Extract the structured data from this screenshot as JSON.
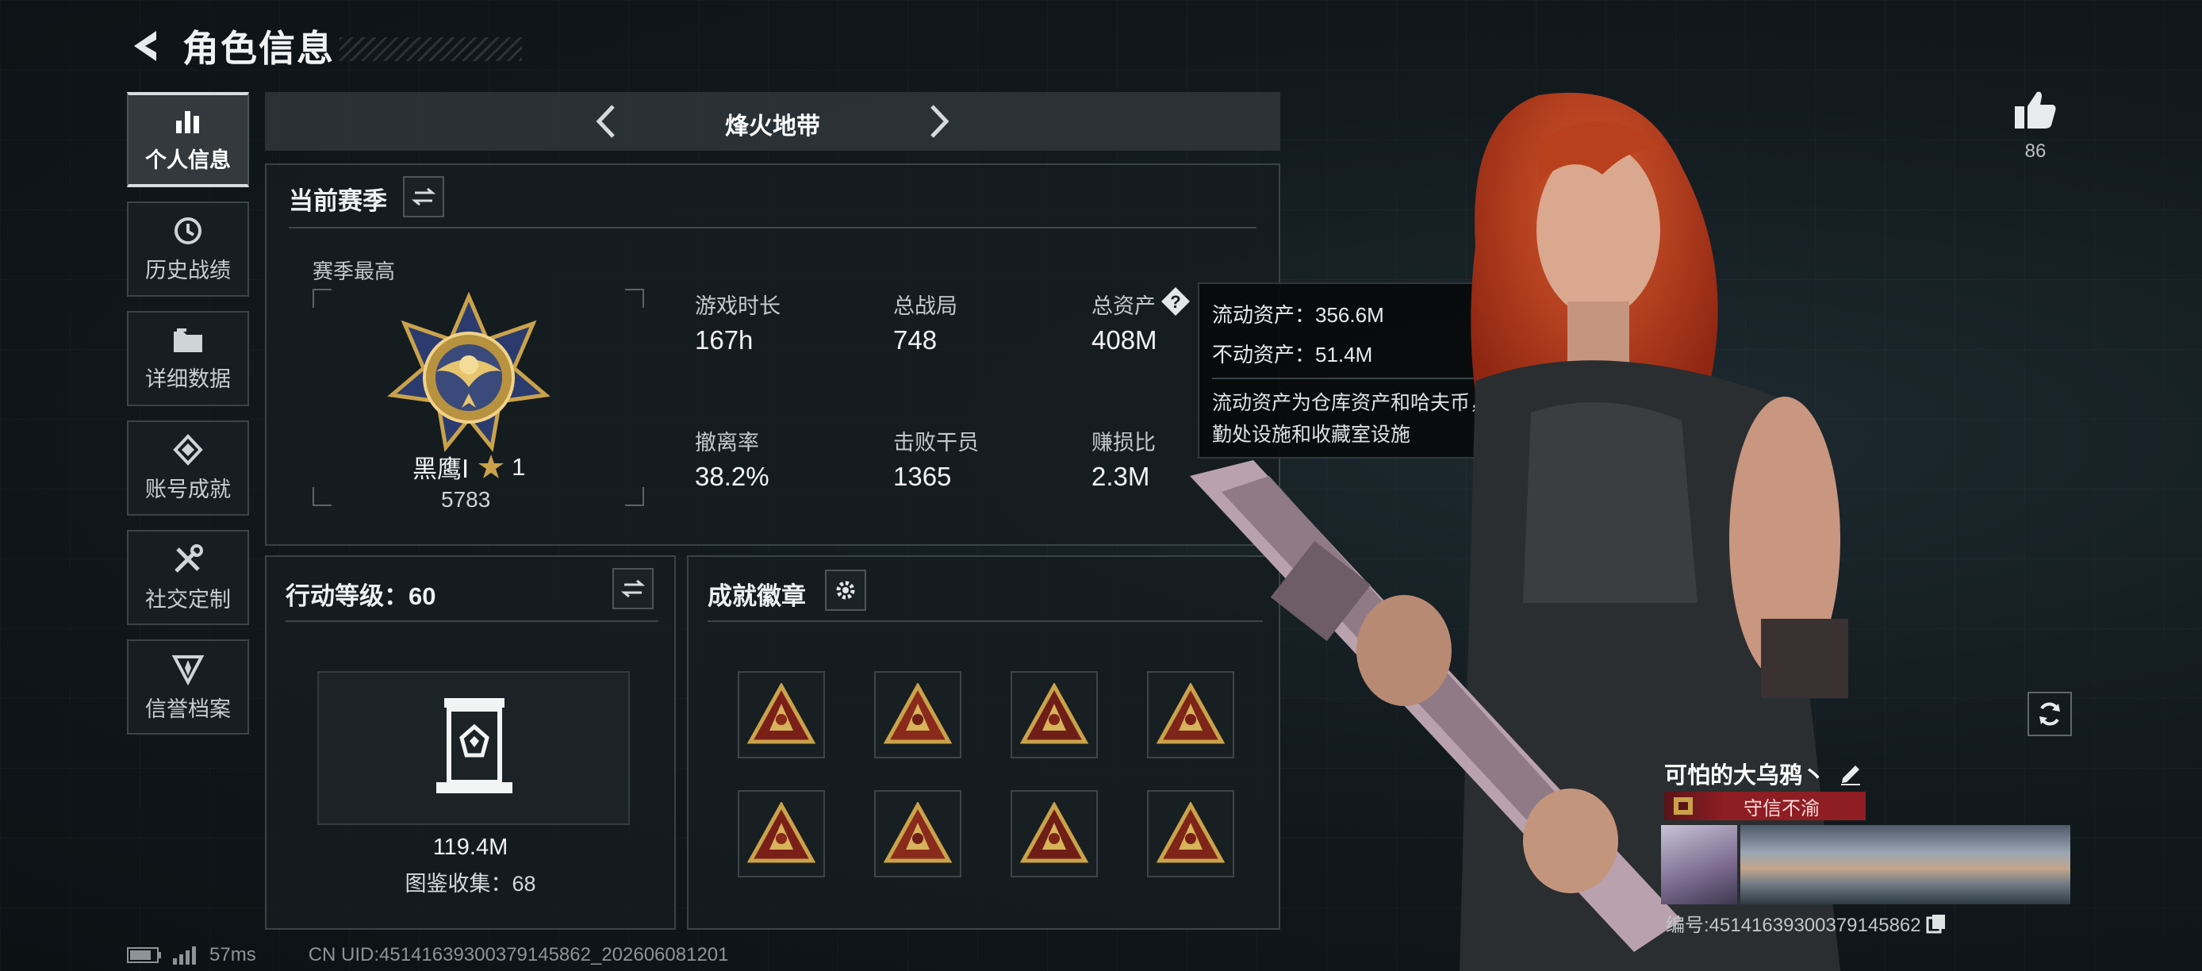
{
  "header": {
    "title": "角色信息"
  },
  "sidebar": {
    "items": [
      {
        "label": "个人信息",
        "icon": "bar-chart-icon",
        "active": true
      },
      {
        "label": "历史战绩",
        "icon": "history-clock-icon"
      },
      {
        "label": "详细数据",
        "icon": "folder-icon"
      },
      {
        "label": "账号成就",
        "icon": "achievement-icon"
      },
      {
        "label": "社交定制",
        "icon": "tools-icon"
      },
      {
        "label": "信誉档案",
        "icon": "credit-shield-icon"
      }
    ]
  },
  "mode": {
    "title": "烽火地带"
  },
  "season": {
    "title": "当前赛季",
    "highest_label": "赛季最高",
    "rank_name": "黑鹰Ⅰ",
    "rank_stars": "1",
    "rank_score": "5783",
    "stats": [
      {
        "label": "游戏时长",
        "value": "167h"
      },
      {
        "label": "总战局",
        "value": "748"
      },
      {
        "label": "总资产",
        "value": "408M"
      },
      {
        "label": "撤离率",
        "value": "38.2%"
      },
      {
        "label": "击败干员",
        "value": "1365"
      },
      {
        "label": "赚损比",
        "value": "2.3M"
      }
    ]
  },
  "tooltip": {
    "liquid": "流动资产：356.6M",
    "fixed": "不动资产：51.4M",
    "desc": "流动资产为仓库资产和哈夫币，不动资产为特勤处设施和收藏室设施"
  },
  "action_level": {
    "title": "行动等级：60",
    "value": "119.4M",
    "collection": "图鉴收集：68"
  },
  "badges": {
    "title": "成就徽章",
    "items": [
      "badge-1",
      "badge-2",
      "badge-3",
      "badge-4",
      "badge-5",
      "badge-6",
      "badge-7",
      "badge-8"
    ]
  },
  "likes": {
    "count": "86"
  },
  "player": {
    "name": "可怕的大乌鸦丶",
    "title": "守信不渝",
    "id": "编号:451416393003791458​62"
  },
  "footer": {
    "ping": "57ms",
    "uid": "CN UID:451416393003791458​62_202606081201"
  },
  "colors": {
    "accent_gold": "#c9a24a",
    "title_red": "#8e1e24"
  }
}
